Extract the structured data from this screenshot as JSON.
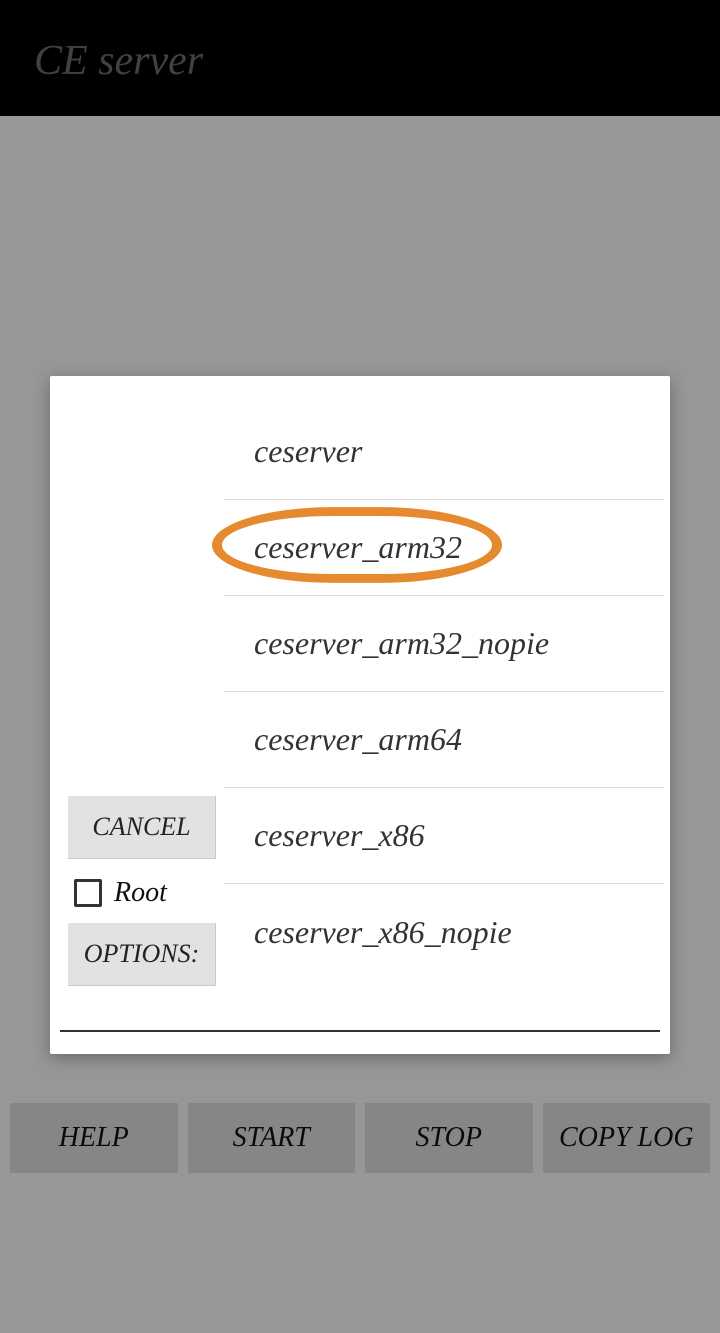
{
  "header": {
    "title": "CE server"
  },
  "bottom_buttons": {
    "help": "HELP",
    "start": "START",
    "stop": "STOP",
    "copy_log": "COPY LOG"
  },
  "dialog": {
    "cancel_label": "CANCEL",
    "root_label": "Root",
    "options_label": "OPTIONS:",
    "list": [
      "ceserver",
      "ceserver_arm32",
      "ceserver_arm32_nopie",
      "ceserver_arm64",
      "ceserver_x86",
      "ceserver_x86_nopie"
    ],
    "highlighted_index": 1
  }
}
